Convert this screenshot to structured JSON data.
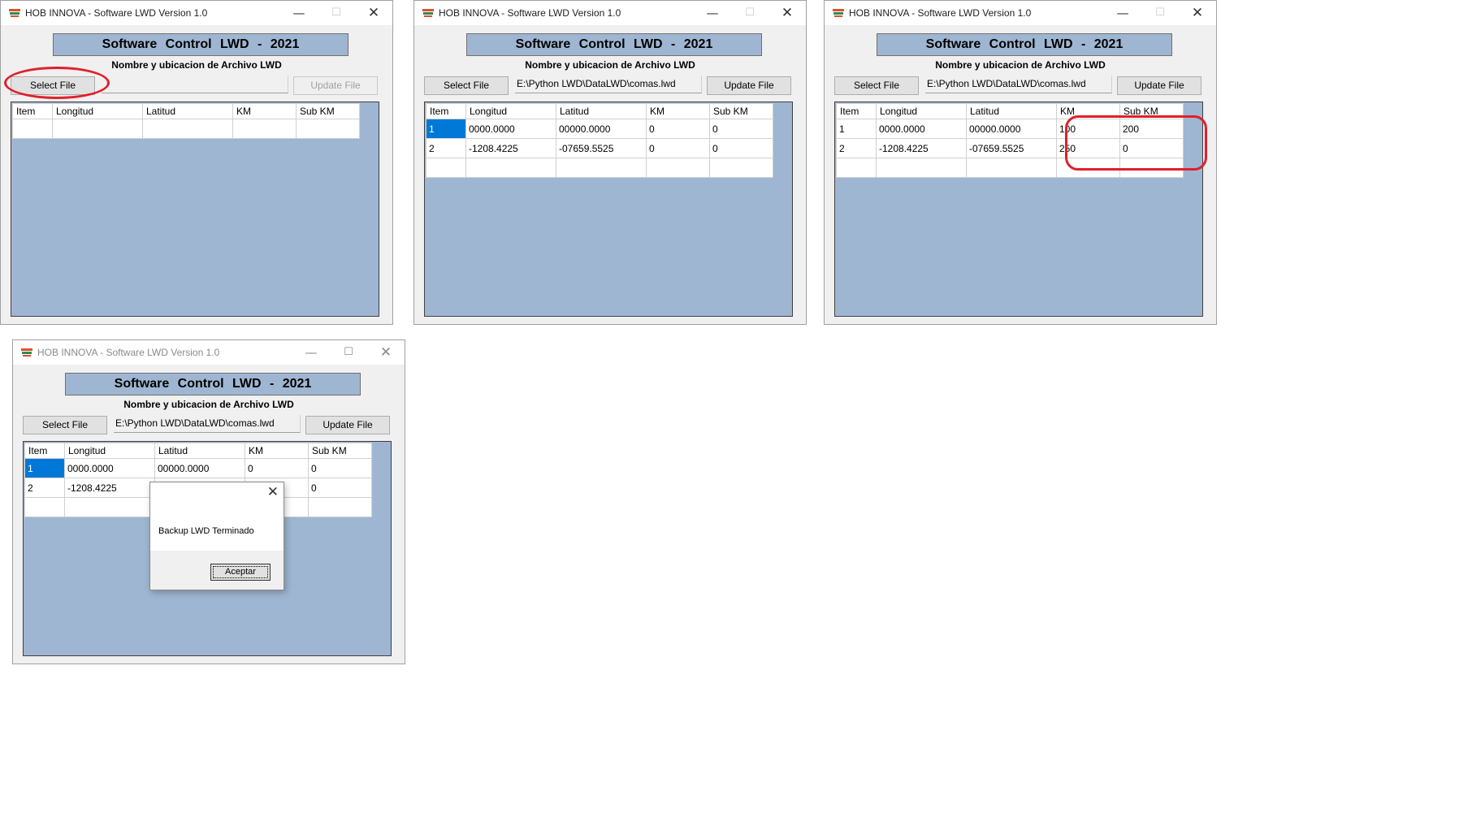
{
  "app": {
    "window_title": "HOB INNOVA - Software LWD Version 1.0",
    "header": "Software  Control  LWD  -  2021",
    "file_caption": "Nombre y ubicacion de Archivo LWD",
    "select_button": "Select File",
    "update_button": "Update File",
    "columns": [
      "Item",
      "Longitud",
      "Latitud",
      "KM",
      "Sub KM"
    ]
  },
  "window_controls": {
    "minimize": "—",
    "maximize": "☐",
    "close": "✕"
  },
  "windows": [
    {
      "file_path": "",
      "update_enabled": false,
      "rows": []
    },
    {
      "file_path": "E:\\Python LWD\\DataLWD\\comas.lwd",
      "update_enabled": true,
      "rows": [
        [
          "1",
          "0000.0000",
          "00000.0000",
          "0",
          "0"
        ],
        [
          "2",
          "-1208.4225",
          "-07659.5525",
          "0",
          "0"
        ]
      ]
    },
    {
      "file_path": "E:\\Python LWD\\DataLWD\\comas.lwd",
      "update_enabled": true,
      "rows": [
        [
          "1",
          "0000.0000",
          "00000.0000",
          "100",
          "200"
        ],
        [
          "2",
          "-1208.4225",
          "-07659.5525",
          "250",
          "0"
        ]
      ]
    },
    {
      "file_path": "E:\\Python LWD\\DataLWD\\comas.lwd",
      "update_enabled": true,
      "rows": [
        [
          "1",
          "0000.0000",
          "00000.0000",
          "0",
          "0"
        ],
        [
          "2",
          "-1208.4225",
          "",
          "",
          "0"
        ]
      ]
    }
  ],
  "dialog": {
    "message": "Backup LWD Terminado",
    "ok_button": "Aceptar",
    "close": "✕"
  },
  "annotation_color": "#e0202a",
  "accent_color": "#9fb6d2"
}
